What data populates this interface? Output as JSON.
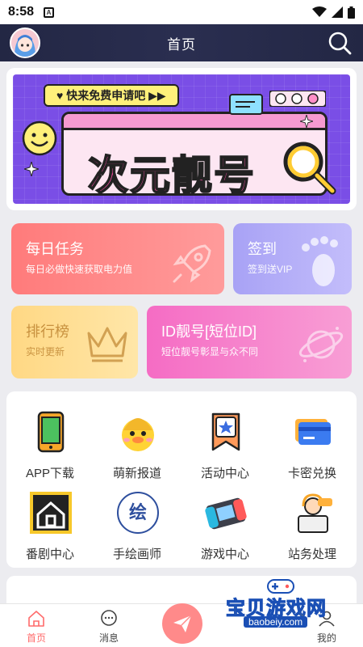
{
  "status": {
    "time": "8:58"
  },
  "header": {
    "title": "首页"
  },
  "banner": {
    "pill": "♥ 快来免费申请吧 ▶▶",
    "title": "次元靓号"
  },
  "cards": {
    "daily": {
      "title": "每日任务",
      "sub": "每日必做快速获取电力值"
    },
    "sign": {
      "title": "签到",
      "sub": "签到送VIP"
    },
    "rank": {
      "title": "排行榜",
      "sub": "实时更新"
    },
    "id": {
      "title": "ID靓号[短位ID]",
      "sub": "短位靓号彰显与众不同"
    }
  },
  "menu": [
    {
      "label": "APP下载",
      "icon": "phone-icon"
    },
    {
      "label": "萌新报道",
      "icon": "duck-icon"
    },
    {
      "label": "活动中心",
      "icon": "bookmark-star-icon"
    },
    {
      "label": "卡密兑换",
      "icon": "card-icon"
    },
    {
      "label": "番剧中心",
      "icon": "anime-house-icon"
    },
    {
      "label": "手绘画师",
      "icon": "paint-icon"
    },
    {
      "label": "游戏中心",
      "icon": "gamepad-icon"
    },
    {
      "label": "站务处理",
      "icon": "support-icon"
    }
  ],
  "tabbar": {
    "home": "首页",
    "messages": "消息",
    "mine": "我的"
  },
  "watermark": {
    "cn": "宝贝游戏网",
    "en": "baobeiy.com"
  },
  "colors": {
    "accent": "#ff6b6b",
    "header_bg": "#232744",
    "banner_bg": "#7a4ee6"
  }
}
